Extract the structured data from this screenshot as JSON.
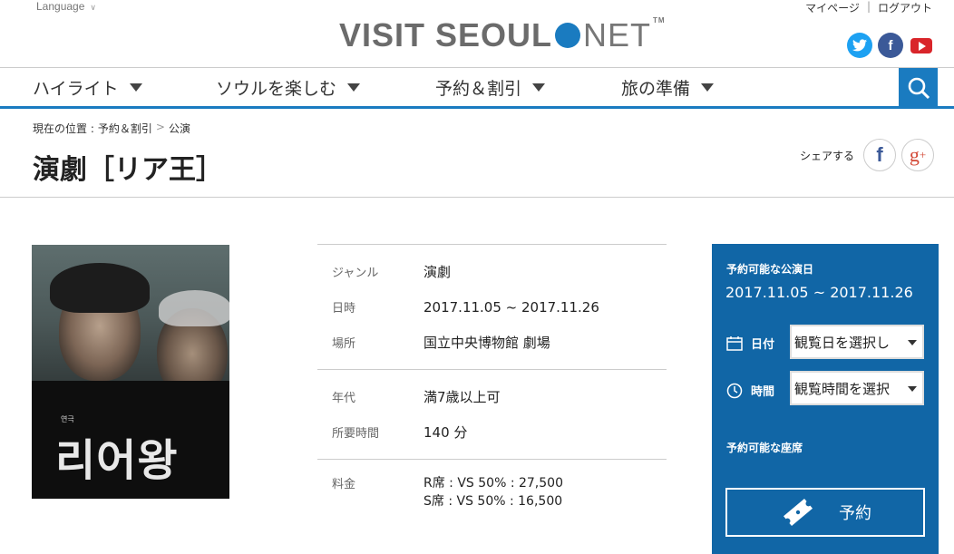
{
  "header": {
    "language": "Language",
    "logo_left": "VISIT SEOUL",
    "logo_right": "NET",
    "logo_tm": "TM",
    "mypage": "マイページ",
    "login": "ログアウト",
    "divider": "|"
  },
  "nav": {
    "items": [
      {
        "label": "ハイライト"
      },
      {
        "label": "ソウルを楽しむ"
      },
      {
        "label": "予約＆割引"
      },
      {
        "label": "旅の準備"
      }
    ]
  },
  "breadcrumb": {
    "prefix": "現在の位置 :",
    "items": [
      "予約＆割引",
      "公演"
    ],
    "arrow": ">"
  },
  "page_title": "演劇［リア王］",
  "share_label": "シェアする",
  "poster": {
    "small_text": "연극",
    "title_text": "리어왕"
  },
  "info": {
    "genre_label": "ジャンル",
    "genre": "演劇",
    "date_label": "日時",
    "date": "2017.11.05 ~ 2017.11.26",
    "venue_label": "場所",
    "venue": "国立中央博物館 劇場",
    "age_label": "年代",
    "age": "満7歳以上可",
    "duration_label": "所要時間",
    "duration": "140 分",
    "price_label": "料金",
    "price_r": "R席 : VS 50% : 27,500",
    "price_s": "S席 : VS 50% : 16,500"
  },
  "panel": {
    "heading": "予約可能な公演日",
    "range": "2017.11.05 ~ 2017.11.26",
    "date_label": "日付",
    "date_select": "観覧日を選択し",
    "time_label": "時間",
    "time_select": "観覧時間を選択",
    "seats_heading": "予約可能な座席",
    "book_label": "予約"
  },
  "colors": {
    "brand": "#1a7bc0",
    "panel": "#1166a6"
  }
}
